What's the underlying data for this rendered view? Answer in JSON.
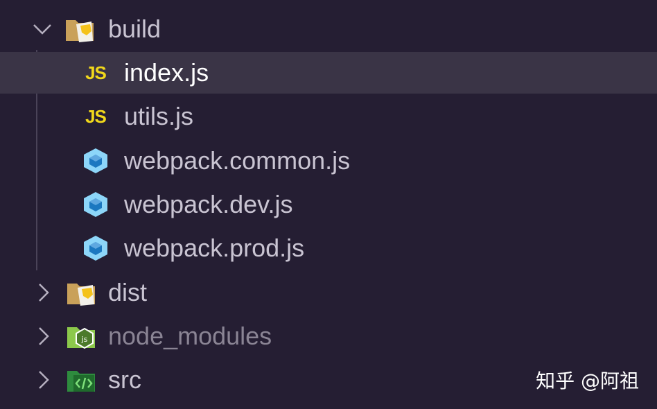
{
  "explorer": {
    "items": [
      {
        "label": "build",
        "type": "folder",
        "icon": "folder-open-icon",
        "expanded": true
      },
      {
        "label": "index.js",
        "type": "file",
        "icon": "js-file-icon",
        "selected": true
      },
      {
        "label": "utils.js",
        "type": "file",
        "icon": "js-file-icon"
      },
      {
        "label": "webpack.common.js",
        "type": "file",
        "icon": "webpack-icon"
      },
      {
        "label": "webpack.dev.js",
        "type": "file",
        "icon": "webpack-icon"
      },
      {
        "label": "webpack.prod.js",
        "type": "file",
        "icon": "webpack-icon"
      },
      {
        "label": "dist",
        "type": "folder",
        "icon": "folder-dist-icon",
        "expanded": false
      },
      {
        "label": "node_modules",
        "type": "folder",
        "icon": "folder-node-icon",
        "expanded": false,
        "dimmed": true
      },
      {
        "label": "src",
        "type": "folder",
        "icon": "folder-src-icon",
        "expanded": false
      }
    ],
    "js_badge": "JS"
  },
  "watermark": "知乎 @阿祖",
  "colors": {
    "background": "#251e33",
    "selected_row": "#3a3446",
    "label": "#c9c4d2",
    "js_badge": "#f1d81b",
    "webpack": "#8dd6f9",
    "node_folder": "#8cc84b",
    "src_folder": "#2e8b3e"
  }
}
